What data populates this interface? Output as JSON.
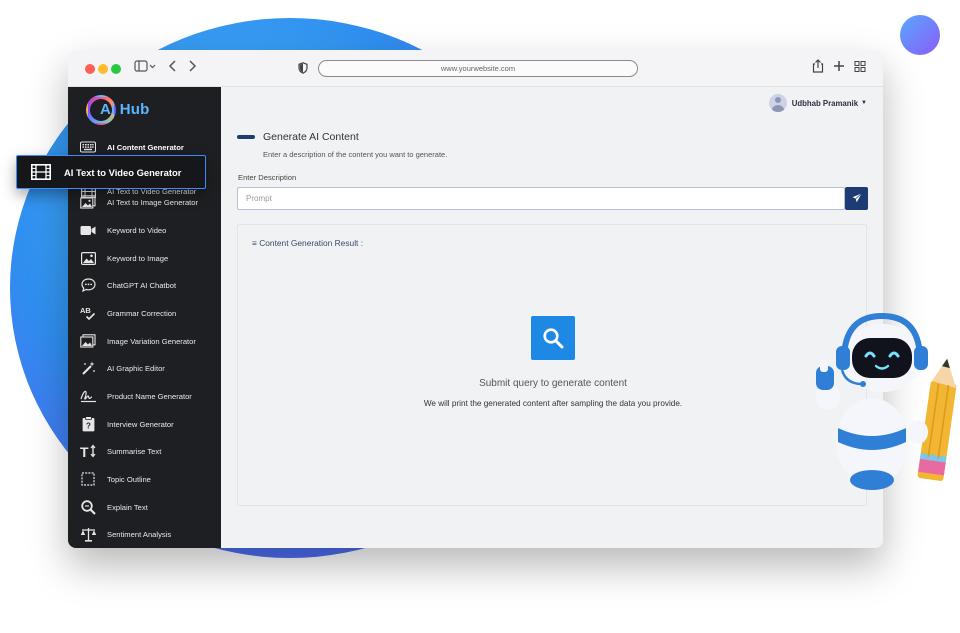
{
  "browser": {
    "url": "www.yourwebsite.com"
  },
  "sidebar": {
    "logo_text": "Ai Hub",
    "items": [
      {
        "label": "AI Content Generator",
        "icon": "keyboard-icon"
      },
      {
        "label": "AI Text to Video Generator",
        "icon": "film-icon"
      },
      {
        "label": "AI Text to Image Generator",
        "icon": "image-icon"
      },
      {
        "label": "Keyword to Video",
        "icon": "video-camera-icon"
      },
      {
        "label": "Keyword to Image",
        "icon": "picture-icon"
      },
      {
        "label": "ChatGPT AI Chatbot",
        "icon": "chat-bubble-icon"
      },
      {
        "label": "Grammar Correction",
        "icon": "spellcheck-icon"
      },
      {
        "label": "Image Variation Generator",
        "icon": "photo-library-icon"
      },
      {
        "label": "AI Graphic Editor",
        "icon": "magic-wand-icon"
      },
      {
        "label": "Product Name Generator",
        "icon": "signature-icon"
      },
      {
        "label": "Interview Generator",
        "icon": "clipboard-question-icon"
      },
      {
        "label": "Summarise Text",
        "icon": "text-size-icon"
      },
      {
        "label": "Topic Outline",
        "icon": "outline-box-icon"
      },
      {
        "label": "Explain Text",
        "icon": "zoom-text-icon"
      },
      {
        "label": "Sentiment Analysis",
        "icon": "scale-icon"
      }
    ]
  },
  "header": {
    "user_name": "Udbhab Pramanik"
  },
  "main": {
    "title": "Generate AI Content",
    "subtitle": "Enter a description of the content you want to generate.",
    "description_label": "Enter Description",
    "prompt_placeholder": "Prompt",
    "result_title": "≡ Content Generation Result :",
    "empty_title": "Submit query to generate content",
    "empty_subtitle": "We will print the generated content after sampling the data you provide."
  },
  "colors": {
    "sidebar_bg": "#1e1f22",
    "accent": "#1f3b73",
    "search_tile": "#1e88e5",
    "highlight_border": "#3d8bff"
  }
}
